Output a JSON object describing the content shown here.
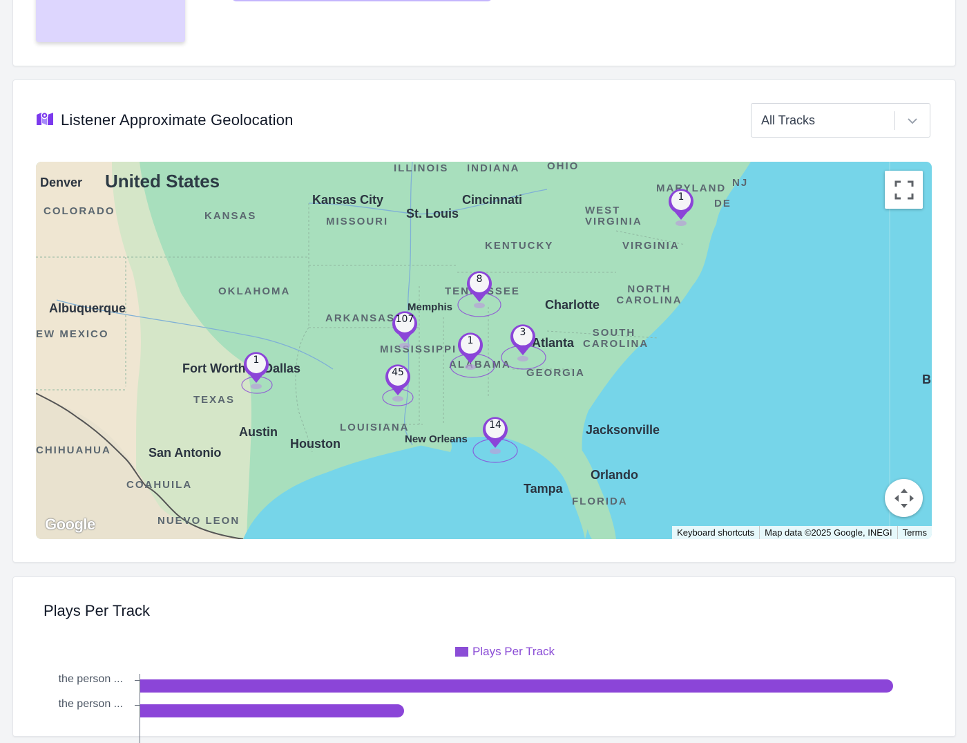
{
  "geolocation": {
    "title": "Listener Approximate Geolocation",
    "filter": {
      "selected": "All Tracks"
    },
    "map": {
      "country_label": "United States",
      "state_labels": [
        {
          "name": "ILLINOIS"
        },
        {
          "name": "INDIANA"
        },
        {
          "name": "OHIO"
        },
        {
          "name": "COLORADO"
        },
        {
          "name": "KANSAS"
        },
        {
          "name": "MISSOURI"
        },
        {
          "name": "WEST VIRGINIA"
        },
        {
          "name": "KENTUCKY"
        },
        {
          "name": "VIRGINIA"
        },
        {
          "name": "OKLAHOMA"
        },
        {
          "name": "TENNESSEE"
        },
        {
          "name": "NORTH CAROLINA"
        },
        {
          "name": "ARKANSAS"
        },
        {
          "name": "SOUTH CAROLINA"
        },
        {
          "name": "EW MEXICO"
        },
        {
          "name": "MISSISSIPPI"
        },
        {
          "name": "ALABAMA"
        },
        {
          "name": "GEORGIA"
        },
        {
          "name": "TEXAS"
        },
        {
          "name": "LOUISIANA"
        },
        {
          "name": "CHIHUAHUA"
        },
        {
          "name": "COAHUILA"
        },
        {
          "name": "FLORIDA"
        },
        {
          "name": "NUEVO LEON"
        },
        {
          "name": "MARYLAND"
        },
        {
          "name": "NJ"
        },
        {
          "name": "DE"
        }
      ],
      "city_labels": [
        {
          "name": "Denver"
        },
        {
          "name": "Kansas City"
        },
        {
          "name": "St. Louis"
        },
        {
          "name": "Cincinnati"
        },
        {
          "name": "Albuquerque"
        },
        {
          "name": "Memphis"
        },
        {
          "name": "Charlotte"
        },
        {
          "name": "Atlanta"
        },
        {
          "name": "Fort Worth"
        },
        {
          "name": "Dallas"
        },
        {
          "name": "Austin"
        },
        {
          "name": "Houston"
        },
        {
          "name": "New Orleans"
        },
        {
          "name": "San Antonio"
        },
        {
          "name": "Jacksonville"
        },
        {
          "name": "Orlando"
        },
        {
          "name": "Tampa"
        },
        {
          "name": "B"
        }
      ],
      "clusters": [
        {
          "name": "maryland",
          "count": "1"
        },
        {
          "name": "tennessee",
          "count": "8"
        },
        {
          "name": "mississippi-north",
          "count": "107"
        },
        {
          "name": "alabama",
          "count": "1"
        },
        {
          "name": "atlanta",
          "count": "3"
        },
        {
          "name": "dallas",
          "count": "1"
        },
        {
          "name": "mississippi-south",
          "count": "45"
        },
        {
          "name": "gulf-coast",
          "count": "14"
        }
      ],
      "logo_text": "Google",
      "attribution": {
        "shortcuts": "Keyboard shortcuts",
        "data": "Map data ©2025 Google, INEGI",
        "terms": "Terms"
      },
      "accent_color": "#8b45d8"
    }
  },
  "plays_per_track": {
    "title": "Plays Per Track",
    "chart_data": {
      "type": "bar",
      "orientation": "horizontal",
      "series": [
        {
          "name": "Plays Per Track",
          "values": [
            100,
            35
          ]
        }
      ],
      "categories": [
        "the person ...",
        "the person ..."
      ],
      "note": "values relative (axis scale not visible)",
      "color": "#8b45d8"
    }
  }
}
